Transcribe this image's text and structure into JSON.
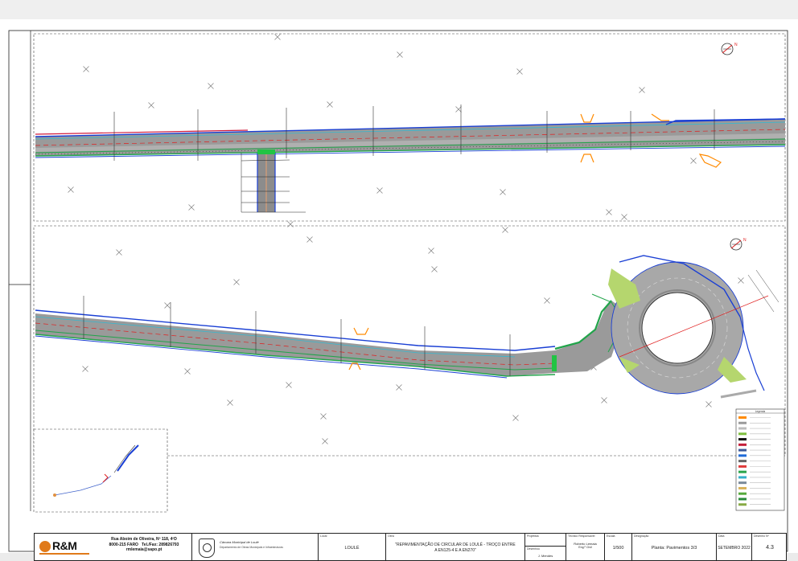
{
  "company": {
    "logo_text": "R&M",
    "address_line1": "Rua Aboim de Oliveira, Nº 118, 4ºD",
    "address_line2": "8000-215 FARO",
    "phone": "Tel./Fax: 289826793",
    "email": "rmlemaia@sapo.pt"
  },
  "municipality": {
    "name": "Câmara Municipal de Loulé",
    "subtitle": "Departamento de Obras Municipais e Infraestruturas"
  },
  "title_block": {
    "local_label": "Local",
    "local_value": "LOULÉ",
    "obra_label": "Obra",
    "obra_line1": "\"REPAVIMENTAÇÃO DE CIRCULAR DE LOULÉ - TROÇO ENTRE",
    "obra_line2": "A EN125-4 E A EN270\"",
    "projetista_label": "Projetista",
    "desenhou_label": "Desenhou",
    "desenhou_value": "J. Mendes",
    "responsavel_label": "Técnico Responsável",
    "responsavel_line1": "Roberto Lemaia",
    "responsavel_line2": "Eng.º Civil",
    "escala_label": "Escala",
    "escala_value": "1/500",
    "desenho_label": "Designação",
    "desenho_value": "Planta: Pavimentos 3/3",
    "data_label": "Data",
    "data_value": "SETEMBRO 2022",
    "numero_label": "Desenho Nº",
    "numero_value": "4.3"
  },
  "legend": {
    "title": "Legenda",
    "colors": [
      "#ff8a00",
      "#9a9a9a",
      "#bcbcbc",
      "#7fbf3f",
      "#111111",
      "#c41e3a",
      "#3d5a99",
      "#1e6ad8",
      "#666666",
      "#e03b3b",
      "#2aa54b",
      "#35b0c9",
      "#7a8a9a",
      "#d8b25a",
      "#56a93c",
      "#2a8a3a",
      "#88aa44"
    ]
  },
  "colors": {
    "road": "#8c8c8c",
    "edge_blue": "#1a3fd4",
    "axis_red": "#e02020",
    "green": "#21a44a",
    "island": "#b5d66e",
    "cyan": "#35b8d0",
    "orange": "#ff8a00"
  },
  "north_arrow_icons": [
    "north-arrow-icon",
    "north-arrow-icon"
  ]
}
